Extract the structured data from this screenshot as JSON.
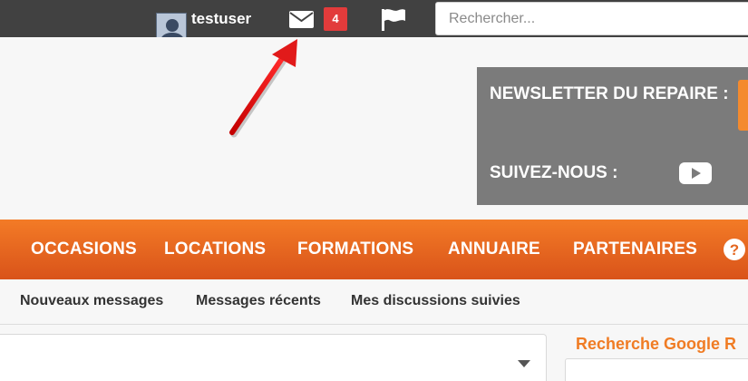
{
  "topbar": {
    "username": "testuser",
    "messages_count": "4",
    "search_placeholder": "Rechercher..."
  },
  "header": {
    "newsletter_label": "NEWSLETTER DU REPAIRE :",
    "follow_label": "SUIVEZ-NOUS :"
  },
  "nav": {
    "items": [
      "OCCASIONS",
      "LOCATIONS",
      "FORMATIONS",
      "ANNUAIRE",
      "PARTENAIRES"
    ]
  },
  "subnav": {
    "items": [
      "Nouveaux messages",
      "Messages récents",
      "Mes discussions suivies"
    ]
  },
  "sidebar": {
    "google_title": "Recherche Google R"
  },
  "icons": {
    "mail": "envelope-icon",
    "flag": "flag-icon",
    "youtube": "youtube-icon",
    "help": "question-circle-icon",
    "annotation": "red-arrow"
  },
  "colors": {
    "topbar": "#414141",
    "nav_orange": "#f37b26",
    "badge_red": "#e23b3b",
    "accent_orange": "#f07c24",
    "gray_box": "#7b7b7b"
  }
}
